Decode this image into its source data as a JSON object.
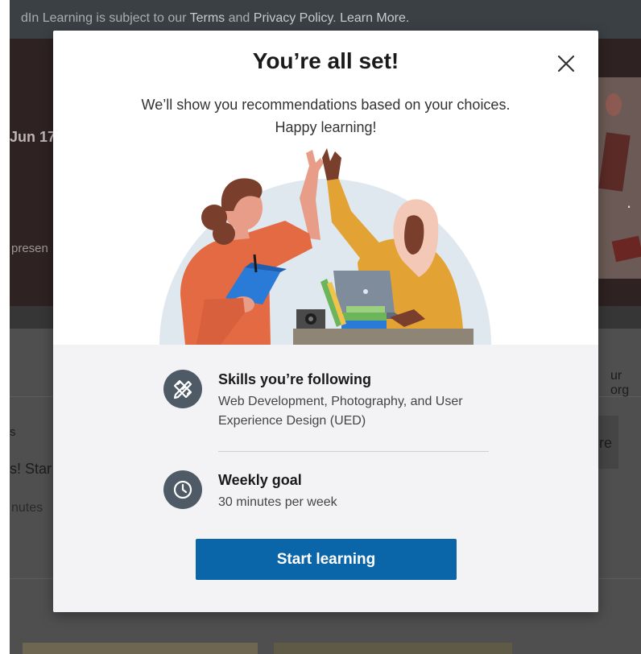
{
  "background": {
    "banner_text_prefix": "dIn Learning is subject to our ",
    "banner_terms": "Terms",
    "banner_and": " and ",
    "banner_privacy": "Privacy Policy",
    "banner_period": ". ",
    "banner_learn_more": "Learn More.",
    "date_fragment": "Jun 17,",
    "present_fragment": "presen",
    "org_fragment": "ur org",
    "s_fragment": "s",
    "start_fragment": "s! Star",
    "minutes_fragment": "nutes",
    "re_fragment": "re",
    "dots": "."
  },
  "modal": {
    "title": "You’re all set!",
    "subtitle_line1": "We’ll show you recommendations based on your choices.",
    "subtitle_line2": "Happy learning!",
    "skills": {
      "icon": "pencil-ruler-icon",
      "title": "Skills you’re following",
      "description": "Web Development, Photography, and User Experience Design (UED)"
    },
    "goal": {
      "icon": "clock-icon",
      "title": "Weekly goal",
      "description": "30 minutes per week"
    },
    "cta_label": "Start learning"
  },
  "colors": {
    "primary_button": "#0a66a8",
    "icon_circle": "#4e5a66",
    "lower_panel": "#f3f3f6"
  }
}
